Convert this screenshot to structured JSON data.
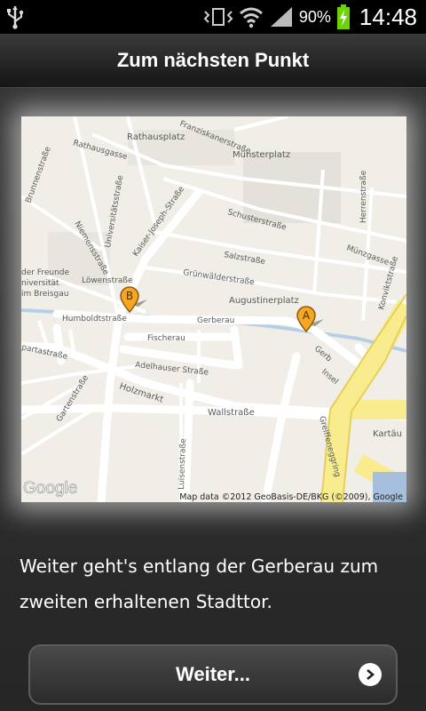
{
  "status_bar": {
    "battery_percent": "90%",
    "time": "14:48",
    "icons": [
      "usb-icon",
      "vibrate-icon",
      "wifi-icon",
      "signal-icon",
      "battery-charging-icon"
    ]
  },
  "header": {
    "title": "Zum nächsten Punkt"
  },
  "map": {
    "attribution": "Map data ©2012 GeoBasis-DE/BKG (©2009), Google",
    "logo": "Google",
    "markers": [
      {
        "label": "B",
        "color": "#f5a623"
      },
      {
        "label": "A",
        "color": "#f5a623"
      }
    ],
    "streets": {
      "rathausplatz": "Rathausplatz",
      "rathausgasse": "Rathausgasse",
      "franziskanerstrasse": "Franziskanerstraße",
      "muensterplatz": "Münsterplatz",
      "brunnenstrasse": "Brunnenstraße",
      "universitaetsstrasse": "Universitätsstraße",
      "kaiser_joseph": "Kaiser-Joseph-Straße",
      "schusterstrasse": "Schusterstraße",
      "herrenstrasse": "Herrenstraße",
      "niemensstrasse": "Niemensstraße",
      "salzstrasse": "Salzstraße",
      "muenzgasse": "Münzgasse",
      "loewenstrasse": "Löwenstraße",
      "gruenwaelderstrasse": "Grünwälderstraße",
      "konviktstrasse": "Konviktstraße",
      "augustinerplatz": "Augustinerplatz",
      "freunde": "der Freunde",
      "universitaet": "niversität",
      "breisgau": "im Breisgau",
      "humboldtstrasse": "Humboldtstraße",
      "gerberau": "Gerberau",
      "fischerau": "Fischerau",
      "gerberau2": "Gerb",
      "adelhauser": "Adelhauser Straße",
      "insel": "Insel",
      "sparta": "partastraße",
      "gartenstrasse": "Gartenstraße",
      "holzmarkt": "Holzmarkt",
      "wallstrasse": "Wallstraße",
      "greiffenegg": "Greiffeneggring",
      "kartaeu": "Kartäu",
      "luisenstrasse": "Luisenstraße"
    }
  },
  "description": "Weiter geht's entlang der Gerberau zum zweiten erhaltenen Stadttor.",
  "button": {
    "label": "Weiter..."
  }
}
